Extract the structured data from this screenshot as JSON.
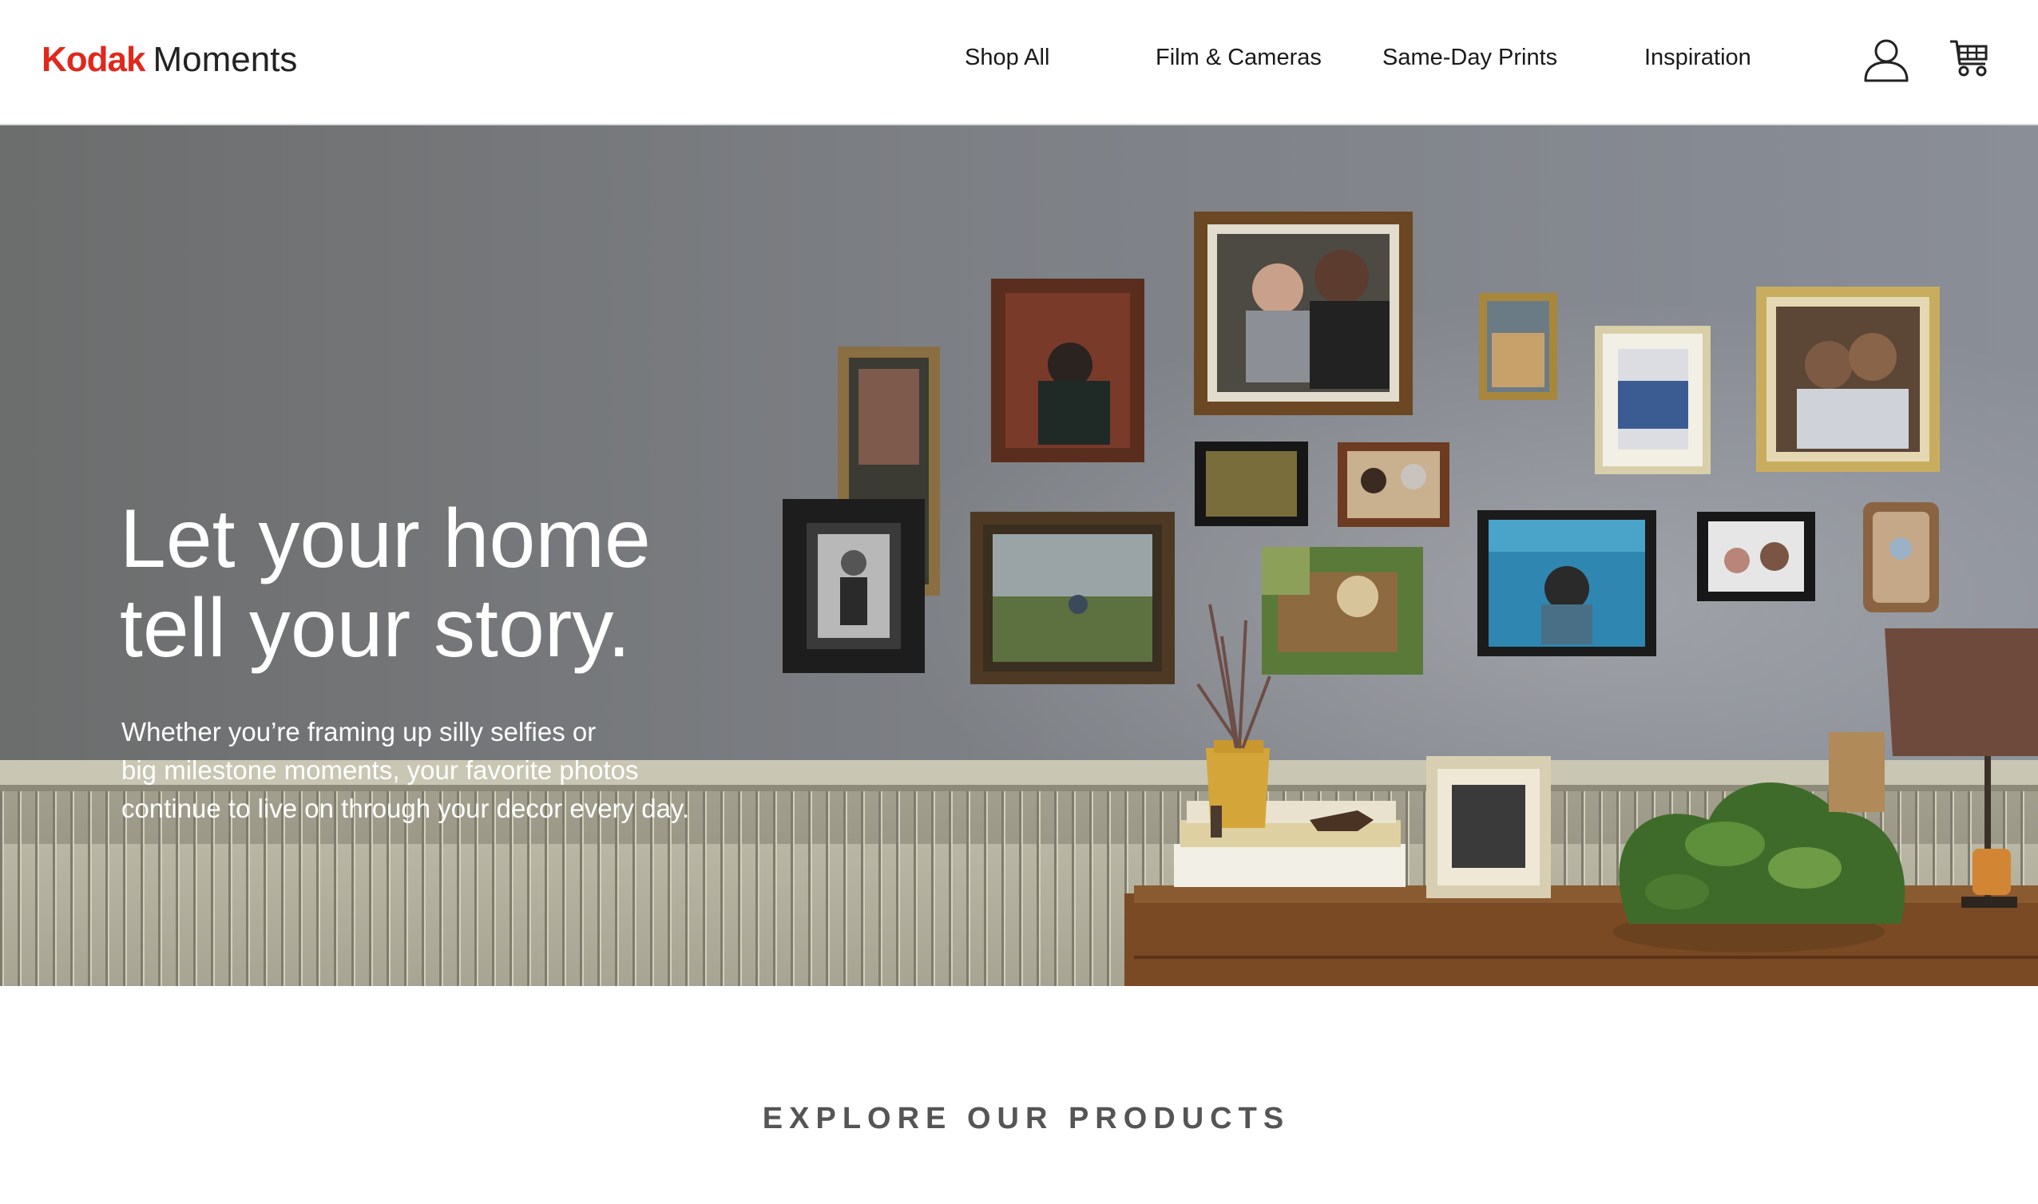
{
  "header": {
    "logo": {
      "brand": "Kodak",
      "product": "Moments"
    },
    "nav": [
      "Shop All",
      "Film & Cameras",
      "Same-Day Prints",
      "Inspiration"
    ],
    "icons": {
      "account": "user-account-icon",
      "cart": "shopping-cart-icon"
    }
  },
  "hero": {
    "title_lines": [
      "Let your home",
      "tell your story."
    ],
    "body_lines": [
      "Whether you’re framing up silly selfies or",
      "big milestone moments, your favorite photos",
      "continue to live on through your decor every day."
    ]
  },
  "products": {
    "heading": "EXPLORE OUR PRODUCTS"
  },
  "colors": {
    "brand": "#e0281c",
    "text": "#1a1a1a",
    "heading": "#555555"
  }
}
